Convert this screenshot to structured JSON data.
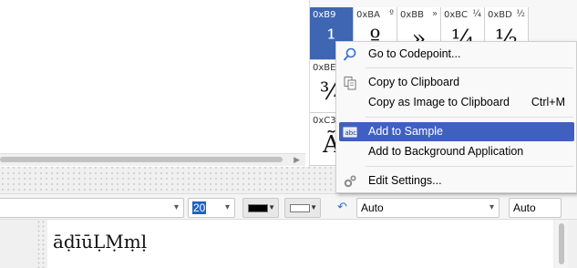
{
  "char_grid": {
    "cells": [
      {
        "code": "0xB9",
        "symbol": "",
        "glyph": "¹",
        "selected": true
      },
      {
        "code": "0xBA",
        "symbol": "º",
        "glyph": "º",
        "selected": false
      },
      {
        "code": "0xBB",
        "symbol": "»",
        "glyph": "»",
        "selected": false
      },
      {
        "code": "0xBC",
        "symbol": "¼",
        "glyph": "¼",
        "selected": false
      },
      {
        "code": "0xBD",
        "symbol": "½",
        "glyph": "½",
        "selected": false
      },
      {
        "code": "0xBE",
        "symbol": "",
        "glyph": "¾",
        "selected": false
      },
      {
        "code": "0xC3",
        "symbol": "",
        "glyph": "Ã",
        "selected": false
      }
    ]
  },
  "context_menu": {
    "go_to_codepoint": "Go to Codepoint...",
    "copy_to_clipboard": "Copy to Clipboard",
    "copy_as_image": "Copy as Image to Clipboard",
    "copy_as_image_shortcut": "Ctrl+M",
    "add_to_sample": "Add to Sample",
    "add_to_background": "Add to Background Application",
    "edit_settings": "Edit Settings..."
  },
  "toolbar": {
    "font_value": "",
    "font_size": "20",
    "foreground_color": "#000000",
    "background_color": "#ffffff",
    "direction_value": "Auto",
    "auto_field": "Auto"
  },
  "preview": {
    "text": "āḍīūḶṂṃḷ"
  },
  "colors": {
    "selection": "#3e66b2",
    "menu_highlight": "#4060c0",
    "size_highlight": "#1e62c9"
  }
}
